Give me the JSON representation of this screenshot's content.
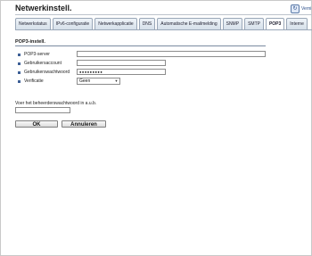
{
  "header": {
    "title": "Netwerkinstell.",
    "top_button_label": "Verni"
  },
  "tabs": [
    {
      "label": "Netwerkstatus"
    },
    {
      "label": "IPv6-configuratie"
    },
    {
      "label": "Netwerkapplicatie"
    },
    {
      "label": "DNS"
    },
    {
      "label": "Automatische E-mailmelding"
    },
    {
      "label": "SNMP"
    },
    {
      "label": "SMTP"
    },
    {
      "label": "POP3",
      "active": true
    },
    {
      "label": "Interne"
    }
  ],
  "section": {
    "title": "POP3-instell.",
    "fields": [
      {
        "label": "POP3-server",
        "value": ""
      },
      {
        "label": "Gebruikersaccount",
        "value": ""
      },
      {
        "label": "Gebruikerswachtwoord",
        "value": "●●●●●●●●●"
      },
      {
        "label": "Verificatie",
        "value": "Geen"
      }
    ]
  },
  "admin_password": {
    "label": "Voer het beheerderswachtwoord in a.u.b.",
    "value": ""
  },
  "buttons": {
    "ok": "OK",
    "cancel": "Annuleren"
  }
}
